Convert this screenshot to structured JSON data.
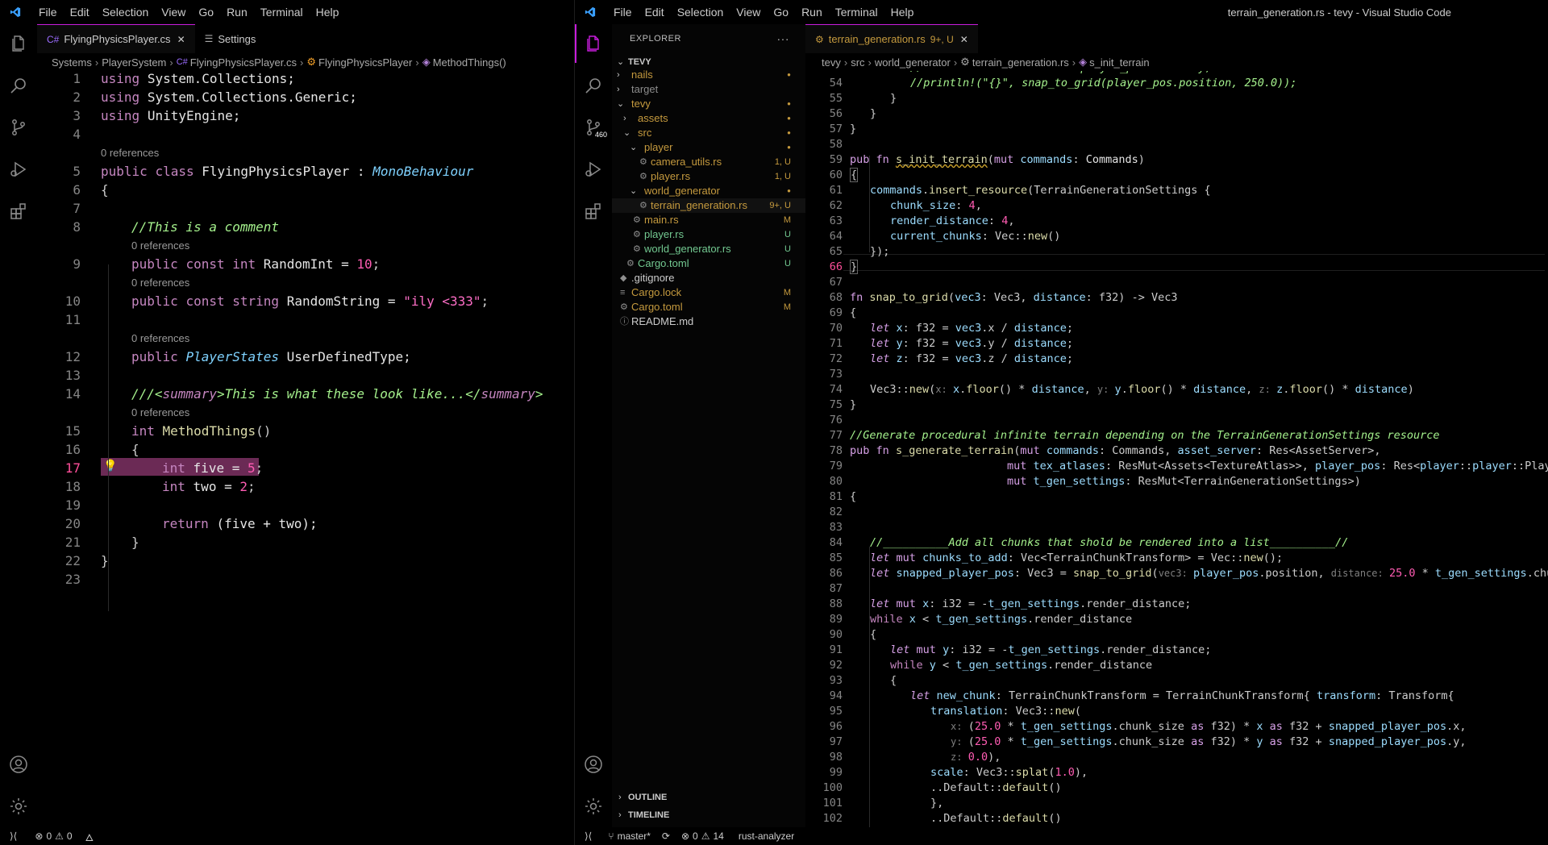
{
  "left": {
    "menu": [
      "File",
      "Edit",
      "Selection",
      "View",
      "Go",
      "Run",
      "Terminal",
      "Help"
    ],
    "tabs": [
      {
        "label": "FlyingPhysicsPlayer.cs",
        "active": true,
        "icon": "csharp-icon"
      },
      {
        "label": "Settings",
        "active": false,
        "icon": "settings-icon"
      }
    ],
    "breadcrumb": [
      "Systems",
      "PlayerSystem",
      "FlyingPhysicsPlayer.cs",
      "FlyingPhysicsPlayer",
      "MethodThings()"
    ],
    "codelens_text": "0 references",
    "status": {
      "errors": "0",
      "warnings": "0"
    }
  },
  "right": {
    "menu": [
      "File",
      "Edit",
      "Selection",
      "View",
      "Go",
      "Run",
      "Terminal",
      "Help"
    ],
    "window_title": "terrain_generation.rs - tevy - Visual Studio Code",
    "scm_badge": "460",
    "explorer": {
      "title": "EXPLORER",
      "root": "TEVY",
      "items": [
        {
          "label": "nails",
          "depth": 1,
          "kind": "folder",
          "open": false,
          "color": "#c59a3e",
          "deco": "●"
        },
        {
          "label": "target",
          "depth": 1,
          "kind": "folder",
          "open": false,
          "color": "#8c8c8c",
          "deco": ""
        },
        {
          "label": "tevy",
          "depth": 1,
          "kind": "folder",
          "open": true,
          "color": "#c59a3e",
          "deco": "●"
        },
        {
          "label": "assets",
          "depth": 2,
          "kind": "folder",
          "open": false,
          "color": "#c59a3e",
          "deco": "●"
        },
        {
          "label": "src",
          "depth": 2,
          "kind": "folder",
          "open": true,
          "color": "#c59a3e",
          "deco": "●"
        },
        {
          "label": "player",
          "depth": 3,
          "kind": "folder",
          "open": true,
          "color": "#c59a3e",
          "deco": "●"
        },
        {
          "label": "camera_utils.rs",
          "depth": 4,
          "kind": "rust",
          "color": "#c59a3e",
          "deco": "1, U"
        },
        {
          "label": "player.rs",
          "depth": 4,
          "kind": "rust",
          "color": "#c59a3e",
          "deco": "1, U"
        },
        {
          "label": "world_generator",
          "depth": 3,
          "kind": "folder",
          "open": true,
          "color": "#c59a3e",
          "deco": "●"
        },
        {
          "label": "terrain_generation.rs",
          "depth": 4,
          "kind": "rust",
          "color": "#c59a3e",
          "deco": "9+, U",
          "selected": true
        },
        {
          "label": "main.rs",
          "depth": 3,
          "kind": "rust",
          "color": "#c59a3e",
          "deco": "M"
        },
        {
          "label": "player.rs",
          "depth": 3,
          "kind": "rust",
          "color": "#73c991",
          "deco": "U"
        },
        {
          "label": "world_generator.rs",
          "depth": 3,
          "kind": "rust",
          "color": "#73c991",
          "deco": "U"
        },
        {
          "label": "Cargo.toml",
          "depth": 2,
          "kind": "gear",
          "color": "#73c991",
          "deco": "U"
        },
        {
          "label": ".gitignore",
          "depth": 1,
          "kind": "diamond",
          "color": "#cccccc",
          "deco": ""
        },
        {
          "label": "Cargo.lock",
          "depth": 1,
          "kind": "lines",
          "color": "#c59a3e",
          "deco": "M"
        },
        {
          "label": "Cargo.toml",
          "depth": 1,
          "kind": "gear",
          "color": "#c59a3e",
          "deco": "M"
        },
        {
          "label": "README.md",
          "depth": 1,
          "kind": "info",
          "color": "#cccccc",
          "deco": ""
        }
      ],
      "outline": "OUTLINE",
      "timeline": "TIMELINE"
    },
    "tab": {
      "label": "terrain_generation.rs",
      "deco": "9+, U"
    },
    "breadcrumb": [
      "tevy",
      "src",
      "world_generator",
      "terrain_generation.rs",
      "s_init_terrain"
    ],
    "status": {
      "branch": "master*",
      "errors": "0",
      "warnings": "14",
      "lsp": "rust-analyzer"
    }
  }
}
